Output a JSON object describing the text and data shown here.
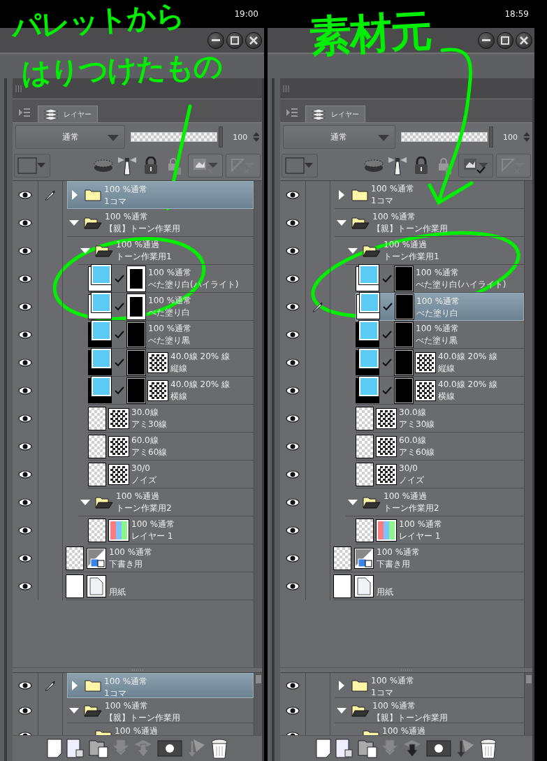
{
  "panels": [
    {
      "clock": "19:00",
      "annotations": [
        "パレットから",
        "はりつけたもの"
      ],
      "tab": {
        "label": "レイヤー",
        "selected": true
      },
      "blend_mode": "通常",
      "opacity": "100",
      "opacity_slider": {
        "level": 1
      },
      "ref_layer_checked": false,
      "layers": [
        {
          "kind": "folder",
          "info": "100 %通常",
          "name": "1コマ",
          "expanded": false,
          "visible": true,
          "editing": true,
          "selected": true
        },
        {
          "kind": "folder",
          "info": "100 %通常",
          "name": "【親】トーン作業用",
          "expanded": true,
          "visible": true,
          "editing": false,
          "selected": false,
          "children": [
            {
              "kind": "folder",
              "info": "100 %通過",
              "name": "トーン作業用1",
              "expanded": true,
              "visible": true,
              "editing": false,
              "selected": false,
              "children": [
                {
                  "kind": "tone",
                  "white_base": true,
                  "framed_mask": true,
                  "pattern": false,
                  "info": "100 %通常",
                  "name": "べた塗り白(ハイライト)",
                  "visible": true,
                  "editing": false,
                  "selected": false
                },
                {
                  "kind": "tone",
                  "white_base": true,
                  "framed_mask": true,
                  "pattern": false,
                  "info": "100 %通常",
                  "name": "べた塗り白",
                  "visible": true,
                  "editing": false,
                  "selected": false
                },
                {
                  "kind": "tone",
                  "white_base": false,
                  "framed_mask": false,
                  "pattern": false,
                  "info": "100 %通常",
                  "name": "べた塗り黒",
                  "visible": true,
                  "editing": false,
                  "selected": false
                },
                {
                  "kind": "tone",
                  "white_base": false,
                  "framed_mask": false,
                  "pattern": true,
                  "info": "40.0線 20% 線",
                  "name": "縦線",
                  "visible": true,
                  "editing": false,
                  "selected": false
                },
                {
                  "kind": "tone",
                  "white_base": false,
                  "framed_mask": false,
                  "pattern": true,
                  "info": "40.0線 20% 線",
                  "name": "横線",
                  "visible": true,
                  "editing": false,
                  "selected": false
                },
                {
                  "kind": "screen",
                  "info": "30.0線",
                  "name": "アミ30線",
                  "visible": true,
                  "editing": false,
                  "selected": false
                },
                {
                  "kind": "screen",
                  "info": "60.0線",
                  "name": "アミ60線",
                  "visible": true,
                  "editing": false,
                  "selected": false
                },
                {
                  "kind": "screen",
                  "info": "30/0",
                  "name": "ノイズ",
                  "visible": true,
                  "editing": false,
                  "selected": false
                }
              ]
            },
            {
              "kind": "folder",
              "info": "100 %通過",
              "name": "トーン作業用2",
              "expanded": true,
              "visible": true,
              "editing": false,
              "selected": false,
              "children": [
                {
                  "kind": "color",
                  "info": "100 %通常",
                  "name": "レイヤー 1",
                  "visible": true,
                  "editing": false,
                  "selected": false
                }
              ]
            }
          ]
        },
        {
          "kind": "draft",
          "info": "100 %通常",
          "name": "下書き用",
          "visible": true,
          "editing": false,
          "selected": false
        },
        {
          "kind": "paper",
          "name": "用紙",
          "visible": true,
          "editing": false,
          "selected": false
        }
      ],
      "lower_layers": [
        {
          "kind": "folder",
          "info": "100 %通常",
          "name": "1コマ",
          "expanded": false,
          "visible": true,
          "editing": true,
          "selected": true
        },
        {
          "kind": "folder",
          "info": "100 %通常",
          "name": "【親】トーン作業用",
          "expanded": true,
          "visible": true,
          "editing": false,
          "selected": false,
          "children": [
            {
              "kind": "folder",
              "info": "100 %通過",
              "visible": true,
              "editing": false,
              "selected": false
            }
          ]
        }
      ]
    },
    {
      "clock": "18:59",
      "annotations": [
        "素材元"
      ],
      "tab": {
        "label": "レイヤー",
        "selected": true
      },
      "blend_mode": "通常",
      "opacity": "100",
      "opacity_slider": {
        "level": 1
      },
      "ref_layer_checked": true,
      "layers": [
        {
          "kind": "folder",
          "info": "100 %通常",
          "name": "1コマ",
          "expanded": false,
          "visible": true,
          "editing": false,
          "selected": false
        },
        {
          "kind": "folder",
          "info": "100 %通常",
          "name": "【親】トーン作業用",
          "expanded": true,
          "visible": true,
          "editing": false,
          "selected": false,
          "children": [
            {
              "kind": "folder",
              "info": "100 %通過",
              "name": "トーン作業用1",
              "expanded": true,
              "visible": true,
              "editing": false,
              "selected": false,
              "children": [
                {
                  "kind": "tone",
                  "white_base": true,
                  "framed_mask": false,
                  "pattern": false,
                  "info": "100 %通常",
                  "name": "べた塗り白(ハイライト)",
                  "visible": true,
                  "editing": false,
                  "selected": false
                },
                {
                  "kind": "tone",
                  "white_base": true,
                  "framed_mask": false,
                  "pattern": false,
                  "info": "100 %通常",
                  "name": "べた塗り白",
                  "visible": true,
                  "editing": true,
                  "selected": true
                },
                {
                  "kind": "tone",
                  "white_base": false,
                  "framed_mask": false,
                  "pattern": false,
                  "info": "100 %通常",
                  "name": "べた塗り黒",
                  "visible": true,
                  "editing": false,
                  "selected": false
                },
                {
                  "kind": "tone",
                  "white_base": false,
                  "framed_mask": false,
                  "pattern": true,
                  "info": "40.0線 20% 線",
                  "name": "縦線",
                  "visible": true,
                  "editing": false,
                  "selected": false
                },
                {
                  "kind": "tone",
                  "white_base": false,
                  "framed_mask": false,
                  "pattern": true,
                  "info": "40.0線 20% 線",
                  "name": "横線",
                  "visible": true,
                  "editing": false,
                  "selected": false
                },
                {
                  "kind": "screen",
                  "info": "30.0線",
                  "name": "アミ30線",
                  "visible": true,
                  "editing": false,
                  "selected": false
                },
                {
                  "kind": "screen",
                  "info": "60.0線",
                  "name": "アミ60線",
                  "visible": true,
                  "editing": false,
                  "selected": false
                },
                {
                  "kind": "screen",
                  "info": "30/0",
                  "name": "ノイズ",
                  "visible": true,
                  "editing": false,
                  "selected": false
                }
              ]
            },
            {
              "kind": "folder",
              "info": "100 %通過",
              "name": "トーン作業用2",
              "expanded": true,
              "visible": true,
              "editing": false,
              "selected": false,
              "children": [
                {
                  "kind": "color",
                  "info": "100 %通常",
                  "name": "レイヤー 1",
                  "visible": true,
                  "editing": false,
                  "selected": false
                }
              ]
            }
          ]
        },
        {
          "kind": "draft",
          "info": "100 %通常",
          "name": "下書き用",
          "visible": true,
          "editing": false,
          "selected": false
        },
        {
          "kind": "paper",
          "name": "用紙",
          "visible": true,
          "editing": false,
          "selected": false
        }
      ],
      "lower_layers": [
        {
          "kind": "folder",
          "info": "100 %通常",
          "name": "1コマ",
          "expanded": false,
          "visible": true,
          "editing": false,
          "selected": false
        },
        {
          "kind": "folder",
          "info": "100 %通常",
          "name": "【親】トーン作業用",
          "expanded": true,
          "visible": true,
          "editing": false,
          "selected": false,
          "children": [
            {
              "kind": "folder",
              "info": "100 %通過",
              "visible": true,
              "editing": false,
              "selected": false
            }
          ]
        }
      ]
    }
  ]
}
